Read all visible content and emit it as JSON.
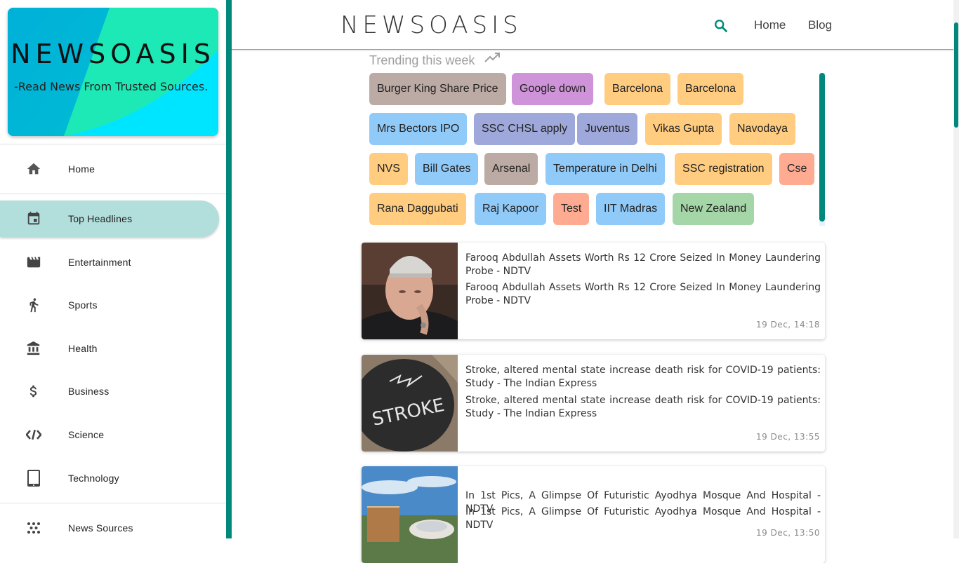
{
  "brand": {
    "title": "NEWSOASIS",
    "tagline": "-Read News From Trusted Sources."
  },
  "sidebar": {
    "items": [
      {
        "label": "Home",
        "icon": "home-icon"
      },
      {
        "label": "Top Headlines",
        "icon": "calendar-icon",
        "active": true
      },
      {
        "label": "Entertainment",
        "icon": "movie-icon"
      },
      {
        "label": "Sports",
        "icon": "running-icon"
      },
      {
        "label": "Health",
        "icon": "bank-icon"
      },
      {
        "label": "Business",
        "icon": "dollar-icon"
      },
      {
        "label": "Science",
        "icon": "code-icon"
      },
      {
        "label": "Technology",
        "icon": "tablet-icon"
      },
      {
        "label": "News Sources",
        "icon": "dots-icon"
      }
    ]
  },
  "header": {
    "title": "NEWSOASIS",
    "links": [
      "Home",
      "Blog"
    ]
  },
  "trending": {
    "heading": "Trending this week",
    "chips": [
      {
        "label": "Burger King Share Price",
        "color": "#bcaaa4"
      },
      {
        "label": "Google down",
        "color": "#ce93d8"
      },
      {
        "label": "Barcelona",
        "color": "#ffcc80"
      },
      {
        "label": "Barcelona",
        "color": "#ffcc80"
      },
      {
        "label": "Mrs Bectors IPO",
        "color": "#90caf9"
      },
      {
        "label": "SSC CHSL apply",
        "color": "#9fa8da"
      },
      {
        "label": "Juventus",
        "color": "#9fa8da"
      },
      {
        "label": "Vikas Gupta",
        "color": "#ffcc80"
      },
      {
        "label": "Navodaya",
        "color": "#ffcc80"
      },
      {
        "label": "NVS",
        "color": "#ffcc80"
      },
      {
        "label": "Bill Gates",
        "color": "#90caf9"
      },
      {
        "label": "Arsenal",
        "color": "#bcaaa4"
      },
      {
        "label": "Temperature in Delhi",
        "color": "#90caf9"
      },
      {
        "label": "SSC registration",
        "color": "#ffcc80"
      },
      {
        "label": "Cse",
        "color": "#ffab91"
      },
      {
        "label": "Rana Daggubati",
        "color": "#ffcc80"
      },
      {
        "label": "Raj Kapoor",
        "color": "#90caf9"
      },
      {
        "label": "Test",
        "color": "#ffab91"
      },
      {
        "label": "IIT Madras",
        "color": "#90caf9"
      },
      {
        "label": "New Zealand",
        "color": "#a5d6a7"
      }
    ]
  },
  "news": [
    {
      "title": "Farooq Abdullah Assets Worth Rs 12 Crore Seized In Money Laundering Probe - NDTV",
      "description": "Farooq Abdullah Assets Worth Rs 12 Crore Seized In Money Laundering Probe - NDTV",
      "time": "19 Dec, 14:18"
    },
    {
      "title": "Stroke, altered mental state increase death risk for COVID-19 patients: Study - The Indian Express",
      "description": "Stroke, altered mental state increase death risk for COVID-19 patients: Study - The Indian Express",
      "time": "19 Dec, 13:55",
      "image_text": "STROKE"
    },
    {
      "title": "In 1st Pics, A Glimpse Of Futuristic Ayodhya Mosque And Hospital - NDTV",
      "description": "In 1st Pics, A Glimpse Of Futuristic Ayodhya Mosque And Hospital - NDTV",
      "time": "19 Dec, 13:50"
    }
  ]
}
